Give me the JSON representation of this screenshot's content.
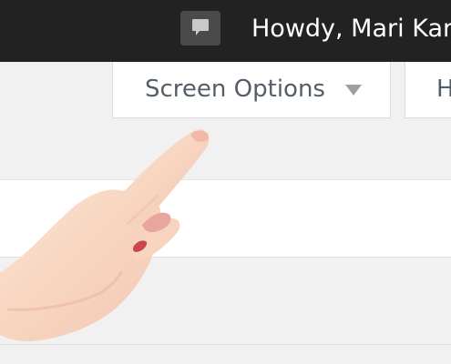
{
  "admin_bar": {
    "greeting": "Howdy, Mari Kar",
    "comments_icon": "comment-bubble-icon"
  },
  "screen_options": {
    "label": "Screen Options",
    "arrow_icon": "triangle-down-icon"
  },
  "help_tab": {
    "label": "H"
  },
  "overlay": {
    "pointer_image": "pointing-hand"
  },
  "colors": {
    "admin_bar_bg": "#222222",
    "page_bg": "#f1f1f1",
    "tab_bg": "#ffffff",
    "tab_text": "#555d66"
  }
}
